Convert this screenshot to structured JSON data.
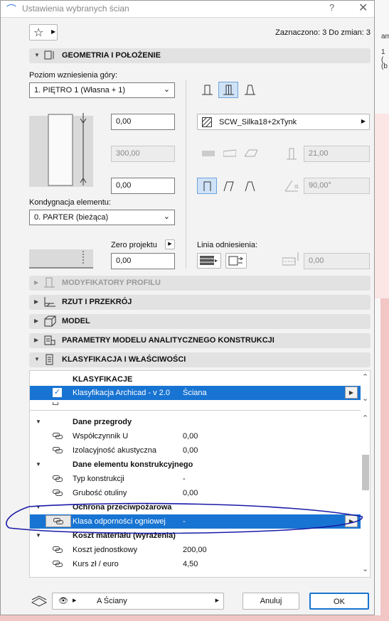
{
  "window": {
    "title": "Ustawienia wybranych ścian",
    "help": "?",
    "close": "✕"
  },
  "header": {
    "selected_text": "Zaznaczono: 3 Do zmian: 3"
  },
  "sections": {
    "geometry": "GEOMETRIA I POŁOŻENIE",
    "profile": "MODYFIKATORY PROFILU",
    "plan": "RZUT I PRZEKRÓJ",
    "model": "MODEL",
    "analytic": "PARAMETRY MODELU ANALITYCZNEGO KONSTRUKCJI",
    "classification": "KLASYFIKACJA I WŁAŚCIWOŚCI"
  },
  "geometry": {
    "top_level_label": "Poziom wzniesienia góry:",
    "top_level_value": "1. PIĘTRO 1 (Własna + 1)",
    "top_offset": "0,00",
    "height": "300,00",
    "bottom_offset": "0,00",
    "home_story_label": "Kondygnacja elementu:",
    "home_story_value": "0. PARTER (bieżąca)",
    "zero_label": "Zero projektu",
    "zero_value": "0,00",
    "composite": "SCW_Silka18+2xTynk",
    "thickness": "21,00",
    "angle": "90,00°",
    "ref_line_label": "Linia odniesienia:",
    "ref_offset": "0,00"
  },
  "classification": {
    "header": "KLASYFIKACJE",
    "system_label": "Klasyfikacja Archicad - v 2.0",
    "system_value": "Ściana",
    "groups": [
      {
        "name": "Dane przegrody",
        "items": [
          {
            "label": "Współczynnik U",
            "value": "0,00"
          },
          {
            "label": "Izolacyjność akustyczna",
            "value": "0,00"
          }
        ]
      },
      {
        "name": "Dane elementu konstrukcyjnego",
        "items": [
          {
            "label": "Typ konstrukcji",
            "value": "-"
          },
          {
            "label": "Grubość otuliny",
            "value": "0,00"
          }
        ]
      },
      {
        "name": "Ochrona przeciwpożarowa",
        "items": [
          {
            "label": "Klasa odporności ogniowej",
            "value": "-"
          }
        ]
      },
      {
        "name": "Koszt materiału (wyrażenia)",
        "items": [
          {
            "label": "Koszt jednostkowy",
            "value": "200,00"
          },
          {
            "label": "Kurs zł / euro",
            "value": "4,50"
          }
        ]
      }
    ]
  },
  "footer": {
    "layer": "A Ściany",
    "cancel": "Anuluj",
    "ok": "OK"
  },
  "background_text": [
    "am",
    "1 (",
    "(b"
  ],
  "colors": {
    "selection": "#1874d2",
    "annotation": "#1a1aa8"
  }
}
